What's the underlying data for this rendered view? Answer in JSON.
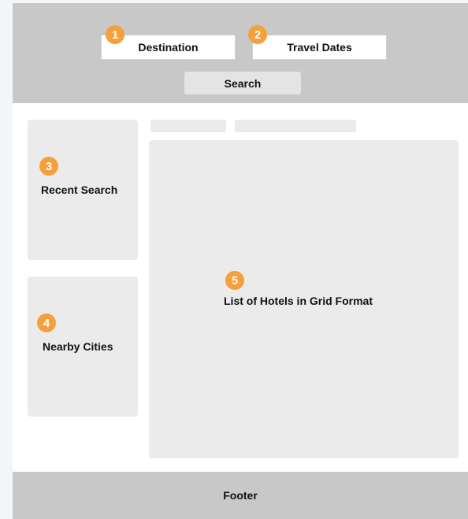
{
  "header": {
    "destination": {
      "badge": "1",
      "label": "Destination"
    },
    "travel_dates": {
      "badge": "2",
      "label": "Travel Dates"
    },
    "search_label": "Search"
  },
  "sidebar": {
    "recent_search": {
      "badge": "3",
      "label": "Recent Search"
    },
    "nearby_cities": {
      "badge": "4",
      "label": "Nearby Cities"
    }
  },
  "main": {
    "hotel_list": {
      "badge": "5",
      "label": "List of Hotels in Grid Format"
    }
  },
  "footer": {
    "label": "Footer"
  },
  "colors": {
    "badge": "#f5a03a",
    "header_bg": "#c8c8c8",
    "panel_bg": "#ebebeb"
  }
}
